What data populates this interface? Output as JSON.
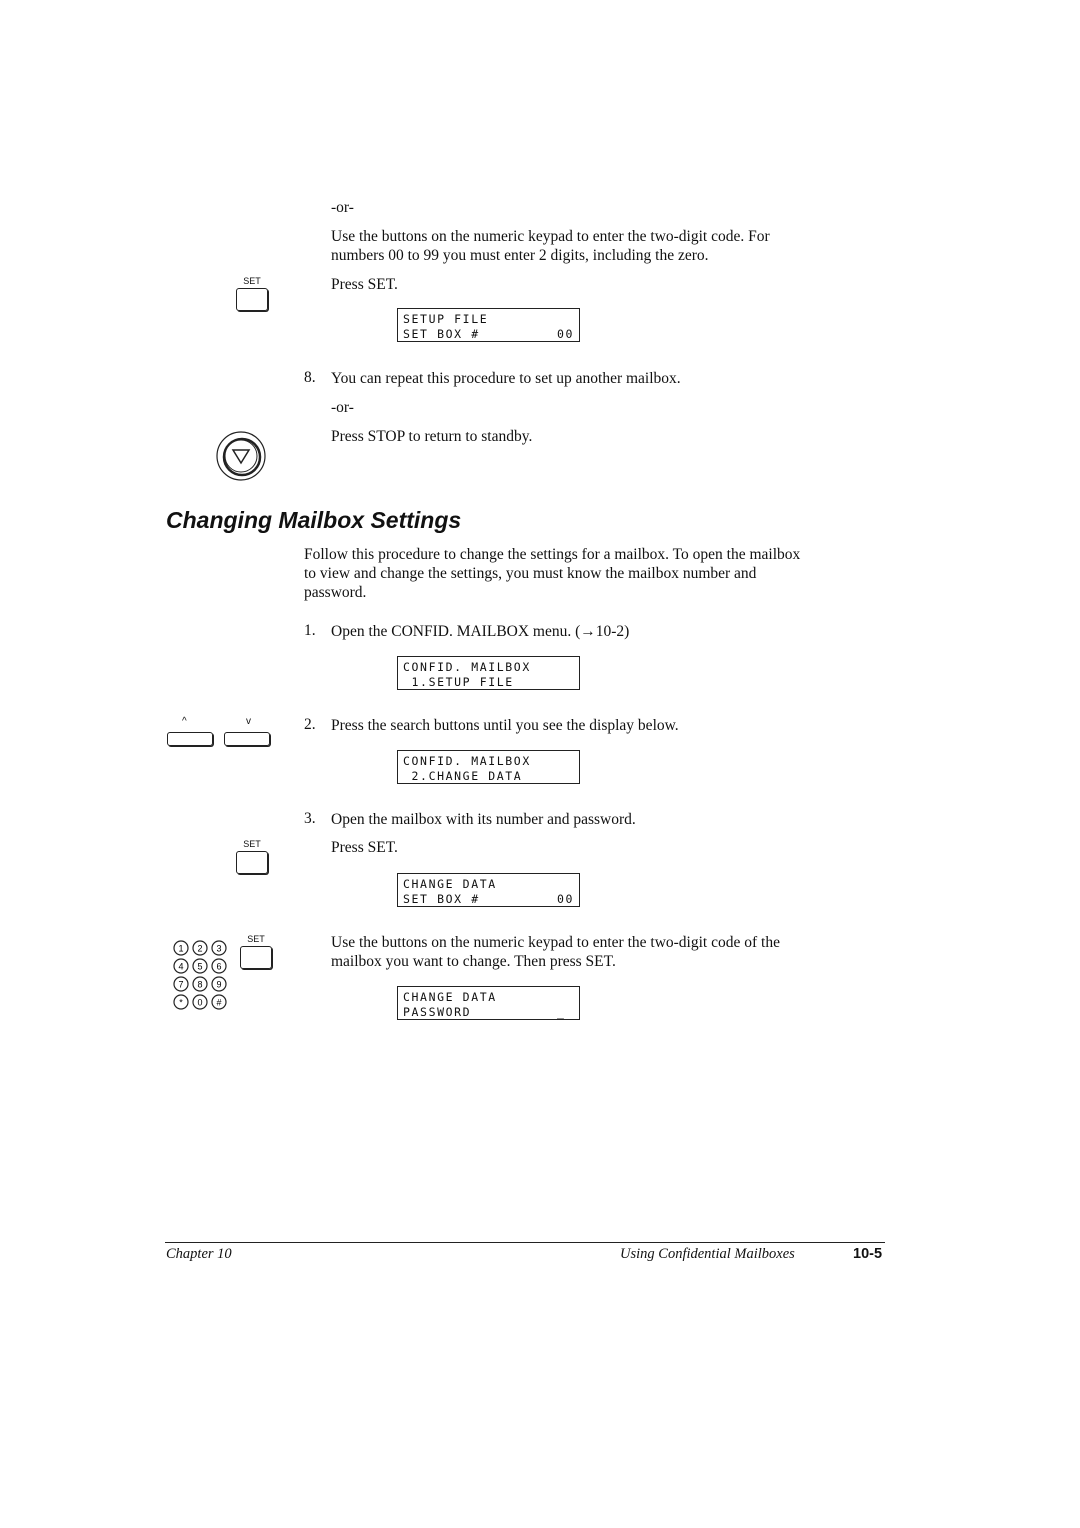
{
  "steps_top": {
    "or1": "-or-",
    "para1": [
      "Use the buttons on the numeric keypad to enter the two-digit code. For",
      "numbers 00 to 99 you must enter 2 digits, including the zero."
    ],
    "press_set": "Press SET.",
    "lcd1": {
      "line1": "SETUP FILE",
      "line2_left": "SET BOX #",
      "line2_right": "00"
    },
    "step8_num": "8.",
    "step8": "You can repeat this procedure to set up another mailbox.",
    "or2": "-or-",
    "press_stop": "Press STOP to return to standby."
  },
  "section": {
    "heading": "Changing Mailbox Settings",
    "intro": [
      "Follow this procedure to change the settings for a mailbox. To open the mailbox",
      "to view and change the settings, you must know the mailbox number and",
      "password."
    ],
    "step1_num": "1.",
    "step1": "Open the CONFID. MAILBOX menu. (→10-2)",
    "lcd2": {
      "line1": "CONFID. MAILBOX",
      "line2_left": " 1.SETUP FILE",
      "line2_right": ""
    },
    "step2_num": "2.",
    "step2": "Press the search buttons until you see the display below.",
    "lcd3": {
      "line1": "CONFID. MAILBOX",
      "line2_left": " 2.CHANGE DATA",
      "line2_right": ""
    },
    "step3_num": "3.",
    "step3": "Open the mailbox with its number and password.",
    "press_set": "Press SET.",
    "lcd4": {
      "line1": "CHANGE DATA",
      "line2_left": "SET BOX #",
      "line2_right": "00"
    },
    "para_keypad": [
      "Use the buttons on the numeric keypad to enter the two-digit code of the",
      "mailbox you want to change. Then press SET."
    ],
    "lcd5": {
      "line1": "CHANGE DATA",
      "line2_left": "PASSWORD",
      "line2_right": "_ "
    }
  },
  "icons": {
    "set_label": "SET",
    "search_up": "^",
    "search_down": "v",
    "keypad_keys": [
      "1",
      "2",
      "3",
      "4",
      "5",
      "6",
      "7",
      "8",
      "9",
      "*",
      "0",
      "#"
    ]
  },
  "footer": {
    "chapter": "Chapter 10",
    "title": "Using Confidential Mailboxes",
    "page": "10-5"
  }
}
